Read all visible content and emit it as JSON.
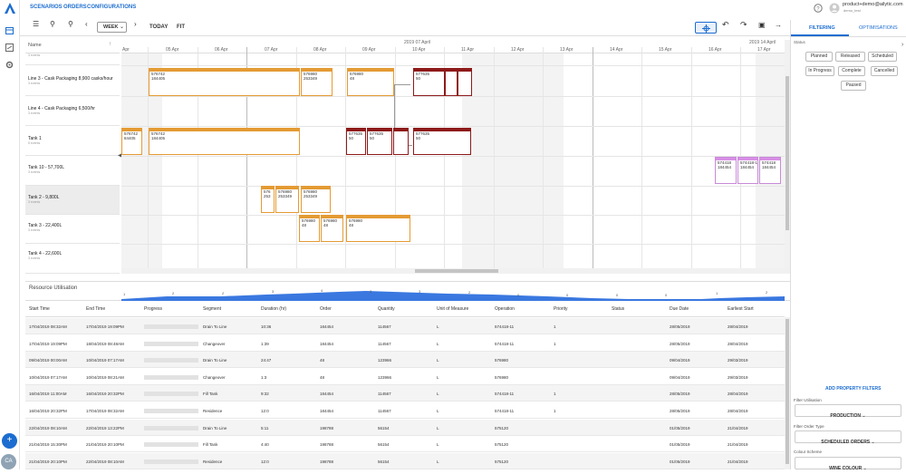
{
  "nav": {
    "scenarios": "SCENARIOS",
    "orders": "ORDERS",
    "configurations": "CONFIGURATIONS"
  },
  "user": {
    "email": "product+demo@ailytic.com",
    "sub": "demo_test"
  },
  "toolbar": {
    "week": "WEEK",
    "today": "TODAY",
    "fit": "FIT"
  },
  "timeline": {
    "top_left": "2019 07 April",
    "top_right": "2019 14 April",
    "days": [
      "Apr",
      "05 Apr",
      "06 Apr",
      "07 Apr",
      "08 Apr",
      "09 Apr",
      "10 Apr",
      "11 Apr",
      "12 Apr",
      "13 Apr",
      "14 Apr",
      "15 Apr",
      "16 Apr",
      "17 Apr"
    ]
  },
  "rows_header": "Name",
  "rows": [
    {
      "name": "",
      "sub": "3 events"
    },
    {
      "name": "Line 3 - Cask Packaging 8,900 casks/hour",
      "sub": "3 events"
    },
    {
      "name": "Line 4 - Cask Packaging 6,500/hr",
      "sub": "3 events"
    },
    {
      "name": "Tank 1",
      "sub": "5 events"
    },
    {
      "name": "Tank 10 - 57,700L",
      "sub": "3 events"
    },
    {
      "name": "Tank 2 - 9,800L",
      "sub": "3 events"
    },
    {
      "name": "Tank 3 - 22,400L",
      "sub": "3 events"
    },
    {
      "name": "Tank 4 - 22,600L",
      "sub": "3 events"
    }
  ],
  "bars": [
    {
      "t": "576742\n184405",
      "c": "o"
    },
    {
      "t": "576980\n253349",
      "c": "o"
    },
    {
      "t": "576980\n48",
      "c": "o"
    },
    {
      "t": "577635\n50",
      "c": "r"
    },
    {
      "t": "",
      "c": "r"
    },
    {
      "t": "",
      "c": "r"
    },
    {
      "t": "576742\n84405",
      "c": "o"
    },
    {
      "t": "576742\n184405",
      "c": "o"
    },
    {
      "t": "577635\n50",
      "c": "r"
    },
    {
      "t": "577635\n50",
      "c": "r"
    },
    {
      "t": "",
      "c": "r"
    },
    {
      "t": "577635\n50",
      "c": "r"
    },
    {
      "t": "574418\n184454",
      "c": "p"
    },
    {
      "t": "574418-1\n184454",
      "c": "p"
    },
    {
      "t": "574418\n184454",
      "c": "p"
    },
    {
      "t": "576\n253",
      "c": "o"
    },
    {
      "t": "576980\n253349",
      "c": "o"
    },
    {
      "t": "576980\n253349",
      "c": "o"
    },
    {
      "t": "576980\n48",
      "c": "o"
    },
    {
      "t": "576980\n48",
      "c": "o"
    },
    {
      "t": "576980\n48",
      "c": "o"
    }
  ],
  "resource": {
    "label": "Resource Utilisation",
    "values": [
      "1",
      "2",
      "2",
      "3",
      "4",
      "3",
      "3",
      "2",
      "0",
      "0",
      "0",
      "0",
      "1",
      "2"
    ]
  },
  "table": {
    "headers": [
      "Start Time",
      "End Time",
      "Progress",
      "Segment",
      "Duration (hr)",
      "Order",
      "Quantity",
      "Unit of Measure",
      "Operation",
      "Priority",
      "Status",
      "Due Date",
      "Earliest Start"
    ],
    "rows": [
      [
        "17/04/2019 08:32AM",
        "17/04/2019 19:09PM",
        "",
        "Drain To Line",
        "10:36",
        "184454",
        "114567",
        "L",
        "574418-11",
        "1",
        "",
        "28/05/2019",
        "28/04/2019"
      ],
      [
        "17/04/2019 19:09PM",
        "18/04/2019 08:48AM",
        "",
        "Changeover",
        "1:39",
        "184454",
        "114567",
        "L",
        "574418-11",
        "1",
        "",
        "28/05/2019",
        "28/04/2019"
      ],
      [
        "09/04/2019 00:00AM",
        "10/04/2019 07:17AM",
        "",
        "Drain To Line",
        "24:47",
        "48",
        "123966",
        "L",
        "576980",
        "",
        "",
        "09/04/2019",
        "29/03/2019"
      ],
      [
        "10/04/2019 07:17AM",
        "10/04/2019 08:21AM",
        "",
        "Changeover",
        "1:3",
        "48",
        "123966",
        "L",
        "576980",
        "",
        "",
        "09/04/2019",
        "29/03/2019"
      ],
      [
        "16/04/2019 11:00AM",
        "16/04/2019 20:32PM",
        "",
        "Fill Tank",
        "9:32",
        "184454",
        "114567",
        "L",
        "574418-11",
        "1",
        "",
        "28/05/2019",
        "28/04/2019"
      ],
      [
        "16/04/2019 20:32PM",
        "17/04/2019 08:32AM",
        "",
        "Residence",
        "12:0",
        "184454",
        "114567",
        "L",
        "574418-11",
        "1",
        "",
        "28/05/2019",
        "28/04/2019"
      ],
      [
        "22/04/2019 08:10AM",
        "22/04/2019 13:22PM",
        "",
        "Drain To Line",
        "5:11",
        "198788",
        "56154",
        "L",
        "575120",
        "",
        "",
        "01/05/2019",
        "21/04/2019"
      ],
      [
        "21/04/2019 15:30PM",
        "21/04/2019 20:10PM",
        "",
        "Fill Tank",
        "4:40",
        "198788",
        "56154",
        "L",
        "575120",
        "",
        "",
        "01/05/2019",
        "21/04/2019"
      ],
      [
        "21/04/2019 20:10PM",
        "22/04/2019 08:10AM",
        "",
        "Residence",
        "12:0",
        "198788",
        "56154",
        "L",
        "575120",
        "",
        "",
        "01/05/2019",
        "21/04/2019"
      ]
    ]
  },
  "panel": {
    "tabs": [
      "FILTERING",
      "OPTIMISATIONS"
    ],
    "status_label": "Status",
    "chips": [
      "Planned",
      "Released",
      "Scheduled",
      "In Progress",
      "Complete",
      "Cancelled",
      "Paused"
    ],
    "add_filters": "ADD PROPERTY FILTERS",
    "filter_util_label": "Filter Utilisation",
    "filter_util_value": "PRODUCTION",
    "filter_order_label": "Filter Order Type",
    "filter_order_value": "SCHEDULED ORDERS",
    "colour_label": "Colour Scheme",
    "colour_value": "WINE COLOUR"
  },
  "avatar": "CA",
  "colors": {
    "accent": "#1c6dd0",
    "orange": "#e49b34",
    "wine": "#8e1a1a",
    "pink": "#d88fe6"
  }
}
